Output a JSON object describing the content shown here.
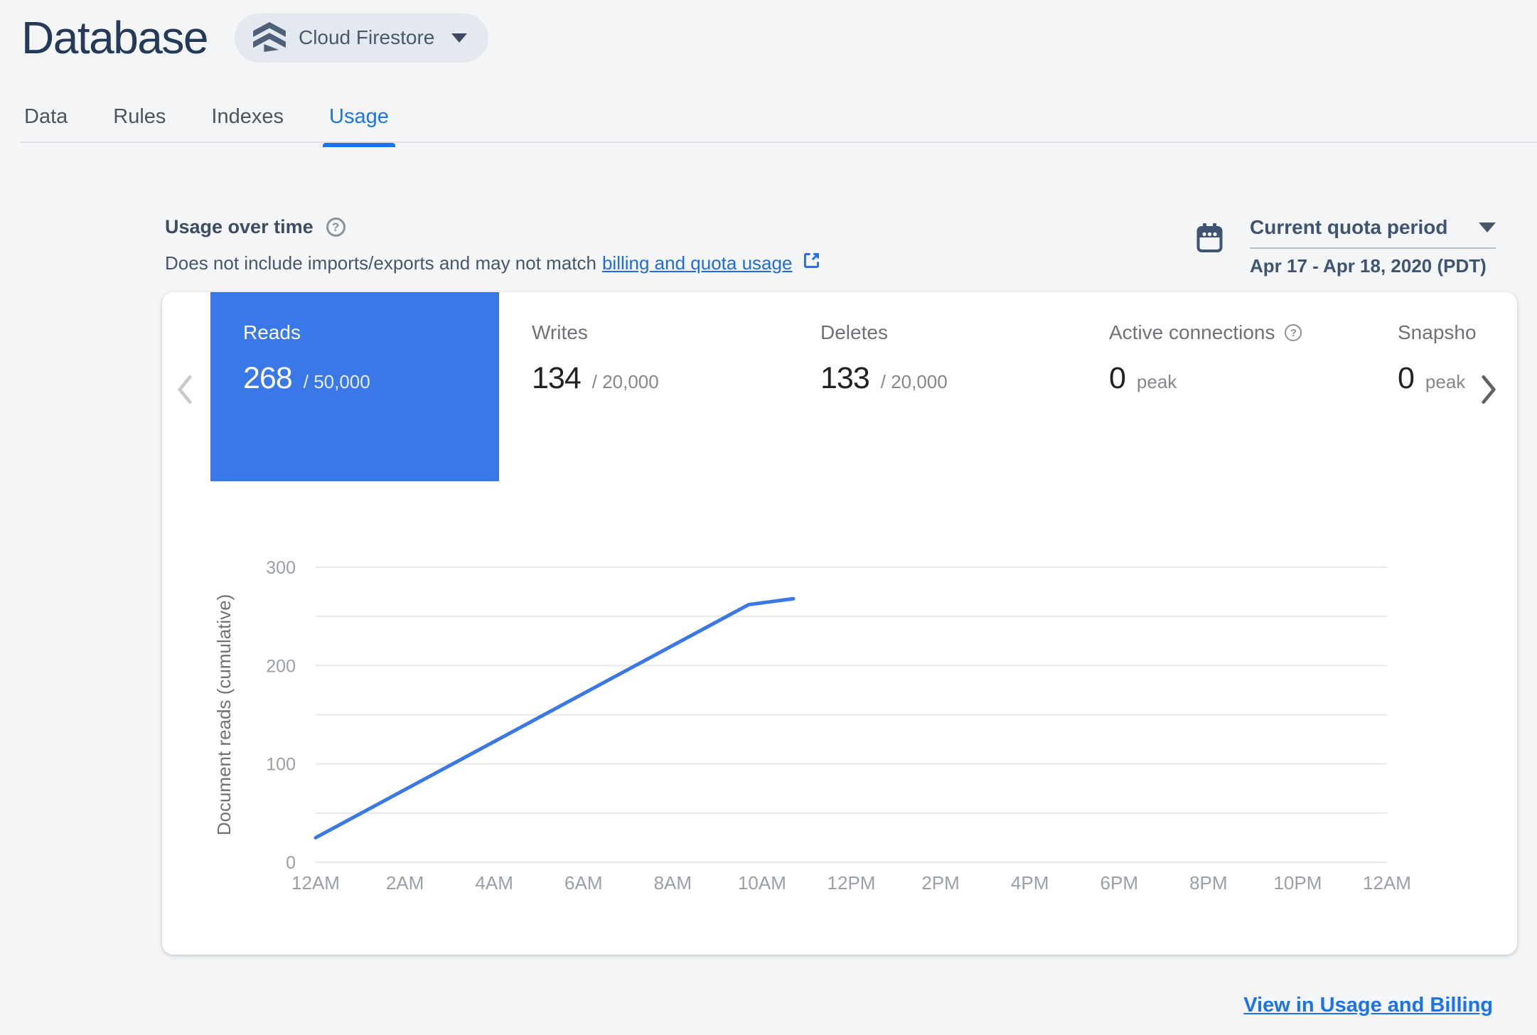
{
  "header": {
    "title": "Database",
    "product_selector": {
      "label": "Cloud Firestore"
    }
  },
  "tabs": {
    "items": [
      {
        "label": "Data",
        "active": false
      },
      {
        "label": "Rules",
        "active": false
      },
      {
        "label": "Indexes",
        "active": false
      },
      {
        "label": "Usage",
        "active": true
      }
    ]
  },
  "usage_section": {
    "heading": "Usage over time",
    "description": "Does not include imports/exports and may not match",
    "description_link": "billing and quota usage",
    "quota_period": {
      "label": "Current quota period",
      "range": "Apr 17 - Apr 18, 2020 (PDT)"
    }
  },
  "metric_cards": [
    {
      "label": "Reads",
      "value": "268",
      "suffix": "/ 50,000",
      "selected": true,
      "has_help": false
    },
    {
      "label": "Writes",
      "value": "134",
      "suffix": "/ 20,000",
      "selected": false,
      "has_help": false
    },
    {
      "label": "Deletes",
      "value": "133",
      "suffix": "/ 20,000",
      "selected": false,
      "has_help": false
    },
    {
      "label": "Active connections",
      "value": "0",
      "suffix": "peak",
      "selected": false,
      "has_help": true
    },
    {
      "label": "Snapsho",
      "value": "0",
      "suffix": "peak",
      "selected": false,
      "has_help": false
    }
  ],
  "chart_data": {
    "type": "line",
    "title": "",
    "xlabel": "",
    "ylabel": "Document reads (cumulative)",
    "x_tick_labels": [
      "12AM",
      "2AM",
      "4AM",
      "6AM",
      "8AM",
      "10AM",
      "12PM",
      "2PM",
      "4PM",
      "6PM",
      "8PM",
      "10PM",
      "12AM"
    ],
    "x_range_hours": [
      0,
      24
    ],
    "ylim": [
      0,
      300
    ],
    "y_labeled_ticks": [
      0,
      100,
      200,
      300
    ],
    "y_grid_step": 50,
    "grid": "horizontal",
    "legend": "none",
    "series": [
      {
        "name": "Document reads (cumulative)",
        "color": "#3b78e7",
        "points_hours_value": [
          [
            0,
            25
          ],
          [
            9.7,
            262
          ],
          [
            10.7,
            268
          ]
        ]
      }
    ]
  },
  "footer": {
    "link_label": "View in Usage and Billing"
  },
  "colors": {
    "accent_blue": "#1a73e8",
    "selected_card_blue": "#3b78e7",
    "title_navy": "#243a57",
    "slate": "#3e5472",
    "grid_gray": "#e7e8ea",
    "axis_label_gray": "#9aa0a6",
    "page_background": "#f3f5f7"
  }
}
